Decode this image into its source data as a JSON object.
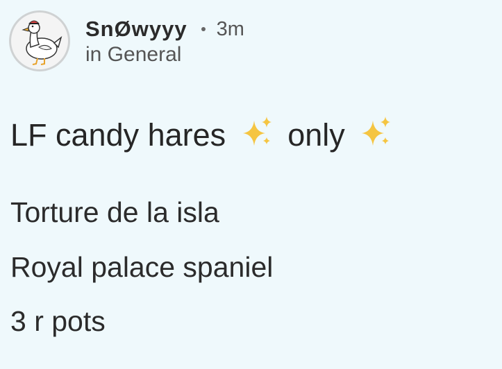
{
  "post": {
    "author": {
      "username": "SnØwyyy",
      "avatar_icon": "duck-avatar"
    },
    "separator": "•",
    "time": "3m",
    "community": "in General",
    "title": {
      "part1": "LF candy hares",
      "part2": "only",
      "emoji_icon": "sparkles-icon"
    },
    "body_lines": [
      "Torture de la isla",
      "Royal palace spaniel",
      "3 r pots"
    ]
  },
  "colors": {
    "background": "#eff9fc",
    "text": "#2a2a2a",
    "muted": "#555555",
    "sparkle_gold": "#f5c542"
  }
}
